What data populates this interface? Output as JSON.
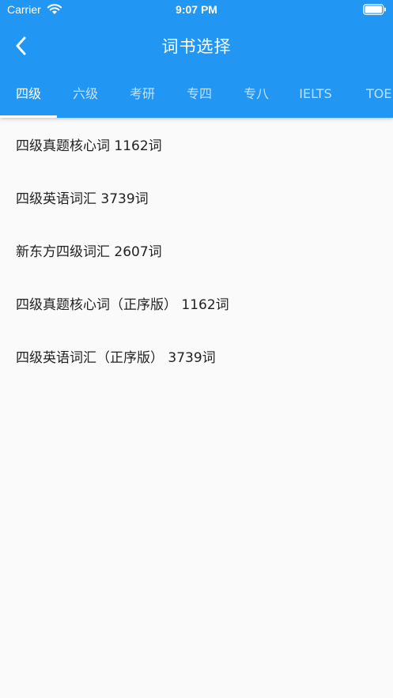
{
  "status_bar": {
    "carrier": "Carrier",
    "time": "9:07 PM"
  },
  "nav": {
    "title": "词书选择",
    "back_icon": "chevron-left-icon"
  },
  "tabs": [
    {
      "label": "四级",
      "active": true
    },
    {
      "label": "六级",
      "active": false
    },
    {
      "label": "考研",
      "active": false
    },
    {
      "label": "专四",
      "active": false
    },
    {
      "label": "专八",
      "active": false
    },
    {
      "label": "IELTS",
      "active": false
    },
    {
      "label": "TOEFL",
      "active": false
    }
  ],
  "books": [
    {
      "label": "四级真题核心词 1162词"
    },
    {
      "label": "四级英语词汇 3739词"
    },
    {
      "label": "新东方四级词汇 2607词"
    },
    {
      "label": "四级真题核心词（正序版） 1162词"
    },
    {
      "label": "四级英语词汇（正序版） 3739词"
    }
  ],
  "colors": {
    "primary": "#2196f3",
    "background": "#fafafa",
    "text": "#222222"
  }
}
